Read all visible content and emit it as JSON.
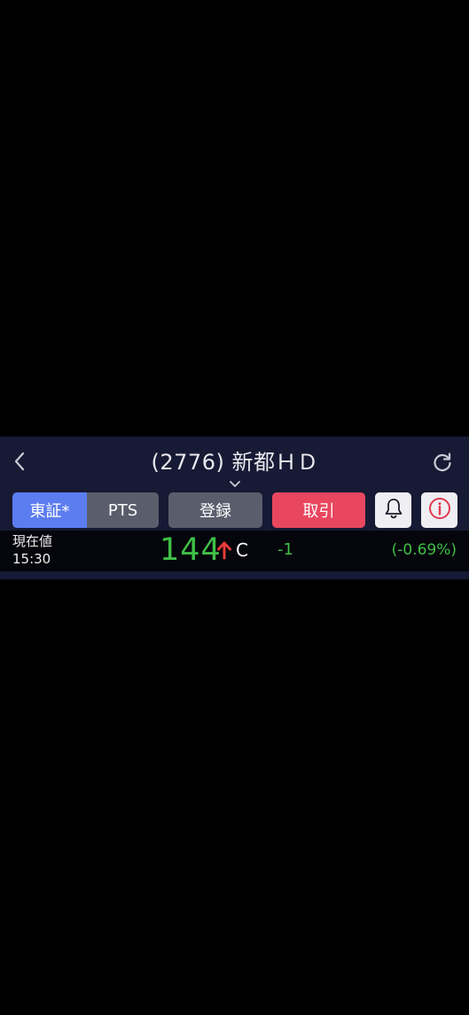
{
  "header": {
    "title": "(2776) 新都ＨＤ",
    "back_icon": "chevron-left-icon",
    "refresh_icon": "refresh-icon",
    "dropdown_icon": "chevron-down-icon"
  },
  "toolbar": {
    "market_tab_tosho": "東証*",
    "market_tab_pts": "PTS",
    "register_label": "登録",
    "trade_label": "取引",
    "alert_icon": "bell-icon",
    "info_icon": "info-icon"
  },
  "quote": {
    "label": "現在値",
    "time": "15:30",
    "price": "144",
    "direction_icon": "up-arrow-icon",
    "flag": "C",
    "change": "-1",
    "change_pct": "(-0.69%)"
  },
  "colors": {
    "background": "#000000",
    "bar": "#171a34",
    "selected_tab": "#5c7df0",
    "trade_button": "#e8475f",
    "price_green": "#3fbf47",
    "arrow_red": "#e83a3a"
  }
}
